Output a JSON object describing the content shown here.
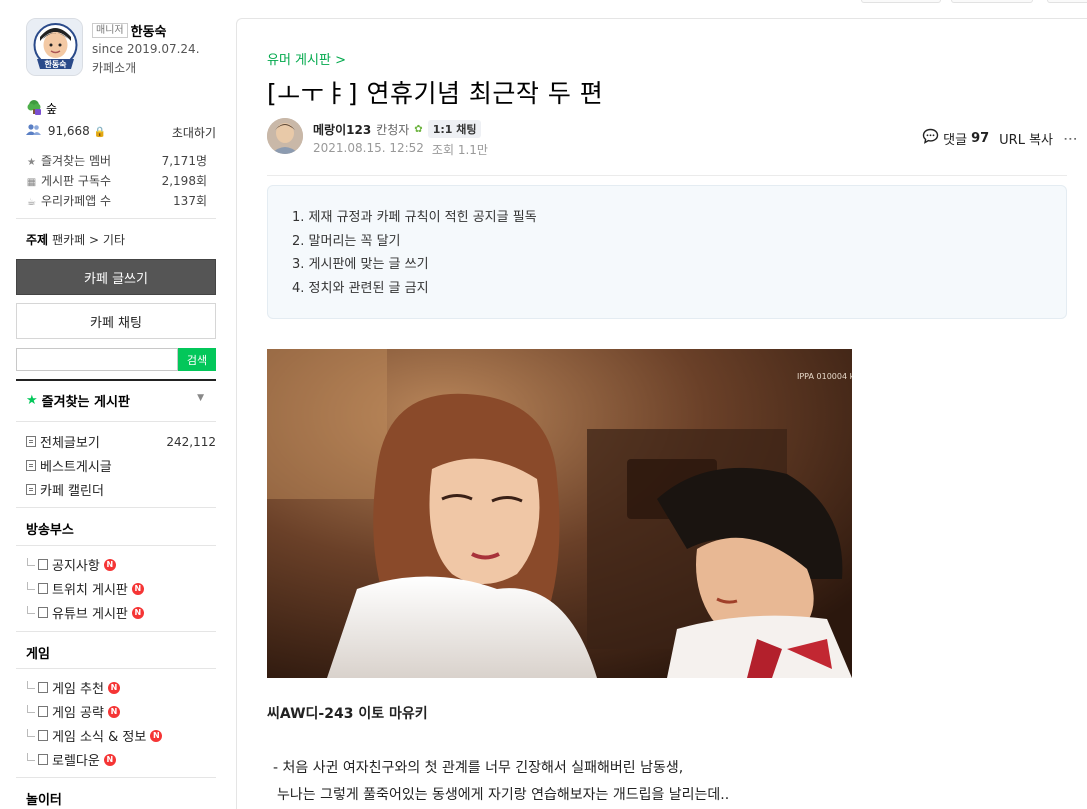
{
  "sidebar": {
    "manager": {
      "badge": "매니저",
      "name": "한동숙",
      "since": "since 2019.07.24.",
      "intro": "카페소개",
      "avatar_text": "한동숙"
    },
    "rank": {
      "icon": "tree-icon",
      "label": "숲"
    },
    "members": {
      "count": "91,668",
      "invite": "초대하기"
    },
    "stats": [
      {
        "icon": "star-icon",
        "label": "즐겨찾는 멤버",
        "value": "7,171명"
      },
      {
        "icon": "rss-icon",
        "label": "게시판 구독수",
        "value": "2,198회"
      },
      {
        "icon": "cafe-app-icon",
        "label": "우리카페앱 수",
        "value": "137회"
      }
    ],
    "subject": {
      "label": "주제",
      "value": "팬카페 > 기타"
    },
    "write_button": "카페 글쓰기",
    "chat_button": "카페 채팅",
    "search": {
      "value": "",
      "button": "검색"
    },
    "favorites": {
      "title": "즐겨찾는 게시판"
    },
    "main_menu": [
      {
        "label": "전체글보기",
        "count": "242,112"
      },
      {
        "label": "베스트게시글",
        "count": ""
      },
      {
        "label": "카페 캘린더",
        "count": ""
      }
    ],
    "sections": [
      {
        "title": "방송부스",
        "items": [
          {
            "label": "공지사항",
            "new": "N"
          },
          {
            "label": "트위치 게시판",
            "new": "N"
          },
          {
            "label": "유튜브 게시판",
            "new": "N"
          }
        ]
      },
      {
        "title": "게임",
        "items": [
          {
            "label": "게임 추천",
            "new": "N"
          },
          {
            "label": "게임 공략",
            "new": "N"
          },
          {
            "label": "게임 소식 & 정보",
            "new": "N"
          },
          {
            "label": "로렐다운",
            "new": "N"
          }
        ]
      },
      {
        "title": "놀이터",
        "items": []
      }
    ]
  },
  "article": {
    "board": "유머 게시판 >",
    "title": "[ㅗㅜㅑ] 연휴기념 최근작 두 편",
    "writer": {
      "name": "메랑이123",
      "grade": "칸청자",
      "chat": "1:1 채팅"
    },
    "date": "2021.08.15. 12:52",
    "views": "조회 1.1만",
    "comment_label": "댓글",
    "comment_count": "97",
    "url_copy": "URL 복사",
    "notice": [
      "1. 제재 규정과 카페 규칙이 적힌 공지글 필독",
      "2. 말머리는 꼭 달기",
      "3. 게시판에 맞는 글 쓰기",
      "4. 정치와 관련된 글 금지"
    ],
    "image_watermark": "IPPA 010004 kawaii*",
    "caption": "씨AW디-243 이토 마유키",
    "body": [
      "- 처음 사귄 여자친구와의 첫 관계를 너무 긴장해서 실패해버린 남동생,",
      "누나는 그렇게 풀죽어있는 동생에게 자기랑 연습해보자는 개드립을 날리는데.."
    ]
  }
}
